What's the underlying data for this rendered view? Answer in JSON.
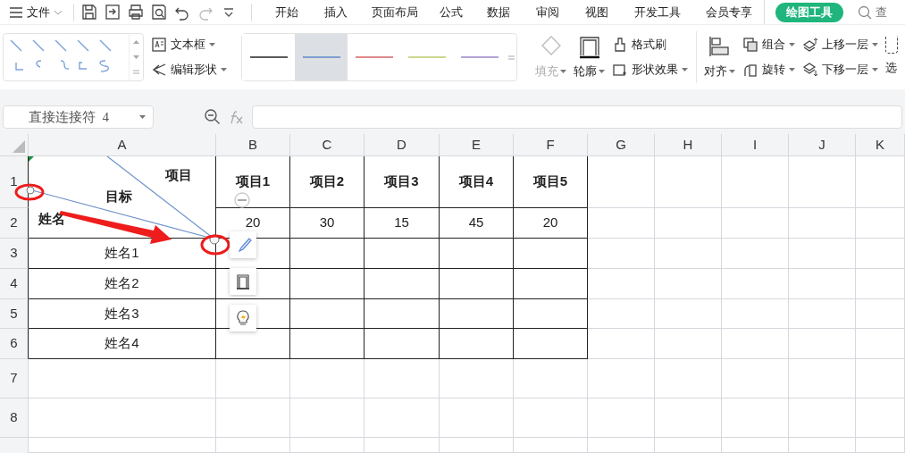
{
  "menu_bar": {
    "file_menu": "文件",
    "tabs": [
      {
        "label": "开始",
        "selected": false
      },
      {
        "label": "插入",
        "selected": false
      },
      {
        "label": "页面布局",
        "selected": false
      },
      {
        "label": "公式",
        "selected": false
      },
      {
        "label": "数据",
        "selected": false
      },
      {
        "label": "审阅",
        "selected": false
      },
      {
        "label": "视图",
        "selected": false
      },
      {
        "label": "开发工具",
        "selected": false
      },
      {
        "label": "会员专享",
        "selected": false
      },
      {
        "label": "绘图工具",
        "selected": true
      }
    ],
    "search_label": "查"
  },
  "ribbon": {
    "text_box": "文本框",
    "edit_shape": "编辑形状",
    "line_styles": [
      {
        "color": "#5a5a5a",
        "selected": false
      },
      {
        "color": "#7f9fd0",
        "selected": true
      },
      {
        "color": "#e08a8a",
        "selected": false
      },
      {
        "color": "#c9d98f",
        "selected": false
      },
      {
        "color": "#b3a3d6",
        "selected": false
      }
    ],
    "fill": {
      "label": "填充",
      "disabled": true
    },
    "outline": {
      "label": "轮廓",
      "disabled": false
    },
    "format_painter": "格式刷",
    "shape_effects": "形状效果",
    "align": "对齐",
    "group": "组合",
    "rotate": "旋转",
    "bring_forward": "上移一层",
    "send_backward": "下移一层",
    "select": "选"
  },
  "formula_bar": {
    "name_box": "直接连接符  4"
  },
  "sheet": {
    "column_headers": [
      "A",
      "B",
      "C",
      "D",
      "E",
      "F",
      "G",
      "H",
      "I",
      "J",
      "K"
    ],
    "row_headers": [
      "1",
      "2",
      "3",
      "4",
      "5",
      "6",
      "7",
      "8"
    ],
    "corner_cell": {
      "top_right": "项目",
      "middle": "目标",
      "bottom_left": "姓名"
    },
    "header_row": [
      "项目1",
      "项目2",
      "项目3",
      "项目4",
      "项目5"
    ],
    "value_row": [
      "20",
      "30",
      "15",
      "45",
      "20"
    ],
    "name_rows": [
      "姓名1",
      "姓名2",
      "姓名3",
      "姓名4"
    ]
  }
}
